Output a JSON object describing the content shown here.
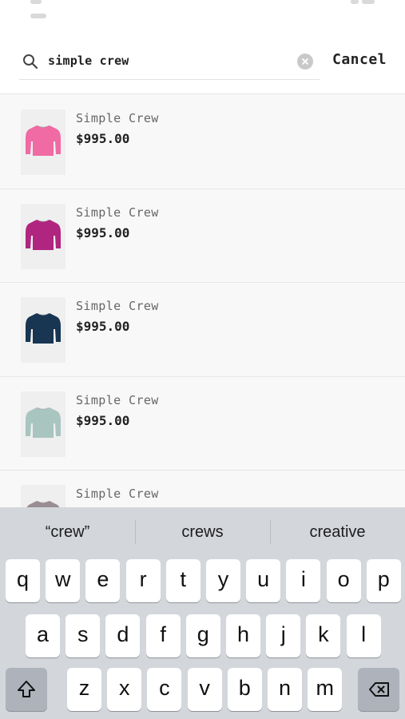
{
  "search": {
    "query": "simple crew",
    "cancel_label": "Cancel"
  },
  "results": [
    {
      "name": "Simple Crew",
      "price": "$995.00",
      "color": "#f06aa3"
    },
    {
      "name": "Simple Crew",
      "price": "$995.00",
      "color": "#b0257f"
    },
    {
      "name": "Simple Crew",
      "price": "$995.00",
      "color": "#183551"
    },
    {
      "name": "Simple Crew",
      "price": "$995.00",
      "color": "#a9c5c0"
    },
    {
      "name": "Simple Crew",
      "price": "",
      "color": "#9a8e92"
    }
  ],
  "keyboard": {
    "predictions": [
      "“crew”",
      "crews",
      "creative"
    ],
    "row1": [
      "q",
      "w",
      "e",
      "r",
      "t",
      "y",
      "u",
      "i",
      "o",
      "p"
    ],
    "row2": [
      "a",
      "s",
      "d",
      "f",
      "g",
      "h",
      "j",
      "k",
      "l"
    ],
    "row3": [
      "z",
      "x",
      "c",
      "v",
      "b",
      "n",
      "m"
    ],
    "shift_icon": "shift-icon",
    "delete_icon": "backspace-icon"
  }
}
